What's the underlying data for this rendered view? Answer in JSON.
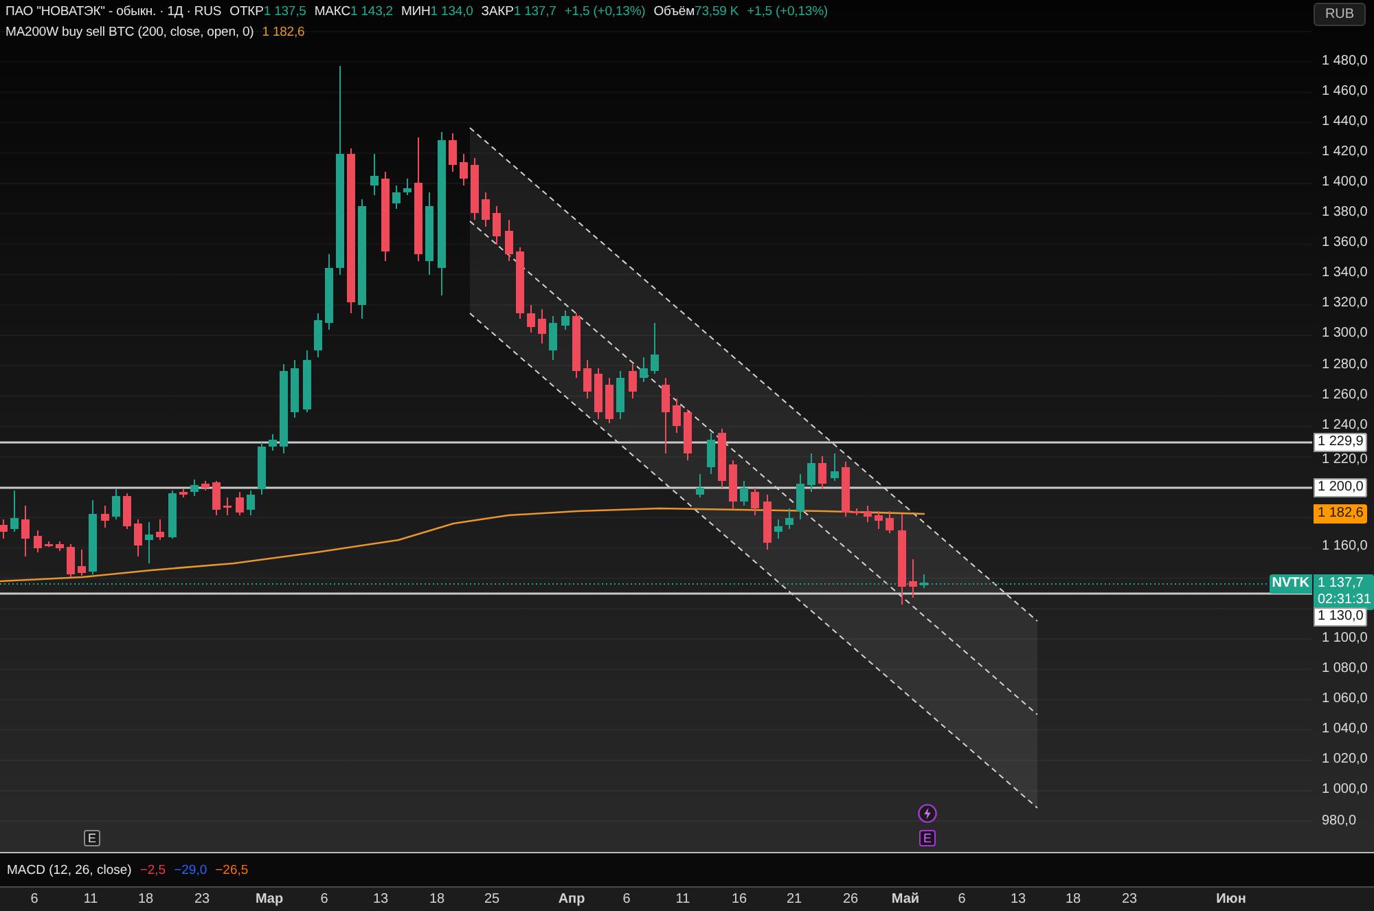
{
  "legend": {
    "title": "ПАО \"НОВАТЭК\" - обыкн. · 1Д · RUS",
    "ohlc": [
      {
        "label": "ОТКР",
        "value": "1 137,5"
      },
      {
        "label": "МАКС",
        "value": "1 143,2"
      },
      {
        "label": "МИН",
        "value": "1 134,0"
      },
      {
        "label": "ЗАКР",
        "value": "1 137,7"
      }
    ],
    "change": "+1,5 (+0,13%)",
    "volume": {
      "label": "Объём",
      "value": "73,59 K",
      "change": "+1,5 (+0,13%)"
    },
    "indicator": {
      "title": "MA200W buy sell BTC (200, close, open, 0)",
      "value": "1 182,6"
    }
  },
  "currency_button": {
    "label": "RUB"
  },
  "price_scale": {
    "labels": [
      "1 480,0",
      "1 460,0",
      "1 440,0",
      "1 420,0",
      "1 400,0",
      "1 380,0",
      "1 360,0",
      "1 340,0",
      "1 320,0",
      "1 300,0",
      "1 280,0",
      "1 260,0",
      "1 240,0",
      "1 220,0",
      "1 160,0",
      "1 100,0",
      "1 080,0",
      "1 060,0",
      "1 040,0",
      "1 020,0",
      "1 000,0",
      "980,0"
    ],
    "levels": [
      {
        "kind": "line",
        "text": "1 229,9"
      },
      {
        "kind": "line",
        "text": "1 200,0"
      },
      {
        "kind": "indicator",
        "text": "1 182,6"
      },
      {
        "kind": "last",
        "symbol": "NVTK",
        "text": "1 137,7",
        "countdown": "02:31:31"
      },
      {
        "kind": "line",
        "text": "1 130,0"
      }
    ]
  },
  "events": [
    {
      "kind": "earnings",
      "label": "E",
      "upcoming": false
    },
    {
      "kind": "news",
      "upcoming": true
    },
    {
      "kind": "earnings",
      "label": "E",
      "upcoming": true
    }
  ],
  "macd": {
    "title": "MACD (12, 26, close)",
    "values": [
      {
        "text": "−2,5",
        "color": "#f23645"
      },
      {
        "text": "−29,0",
        "color": "#2962ff"
      },
      {
        "text": "−26,5",
        "color": "#ff6d00"
      }
    ]
  },
  "time_scale": {
    "labels": [
      {
        "text": "6",
        "kind": "day"
      },
      {
        "text": "11",
        "kind": "day"
      },
      {
        "text": "18",
        "kind": "day"
      },
      {
        "text": "23",
        "kind": "day"
      },
      {
        "text": "Мар",
        "kind": "month"
      },
      {
        "text": "6",
        "kind": "day"
      },
      {
        "text": "13",
        "kind": "day"
      },
      {
        "text": "18",
        "kind": "day"
      },
      {
        "text": "25",
        "kind": "day"
      },
      {
        "text": "Апр",
        "kind": "month"
      },
      {
        "text": "6",
        "kind": "day"
      },
      {
        "text": "11",
        "kind": "day"
      },
      {
        "text": "16",
        "kind": "day"
      },
      {
        "text": "21",
        "kind": "day"
      },
      {
        "text": "26",
        "kind": "day"
      },
      {
        "text": "Май",
        "kind": "month"
      },
      {
        "text": "6",
        "kind": "day"
      },
      {
        "text": "13",
        "kind": "day"
      },
      {
        "text": "18",
        "kind": "day"
      },
      {
        "text": "23",
        "kind": "day"
      },
      {
        "text": "Июн",
        "kind": "month"
      }
    ]
  }
}
